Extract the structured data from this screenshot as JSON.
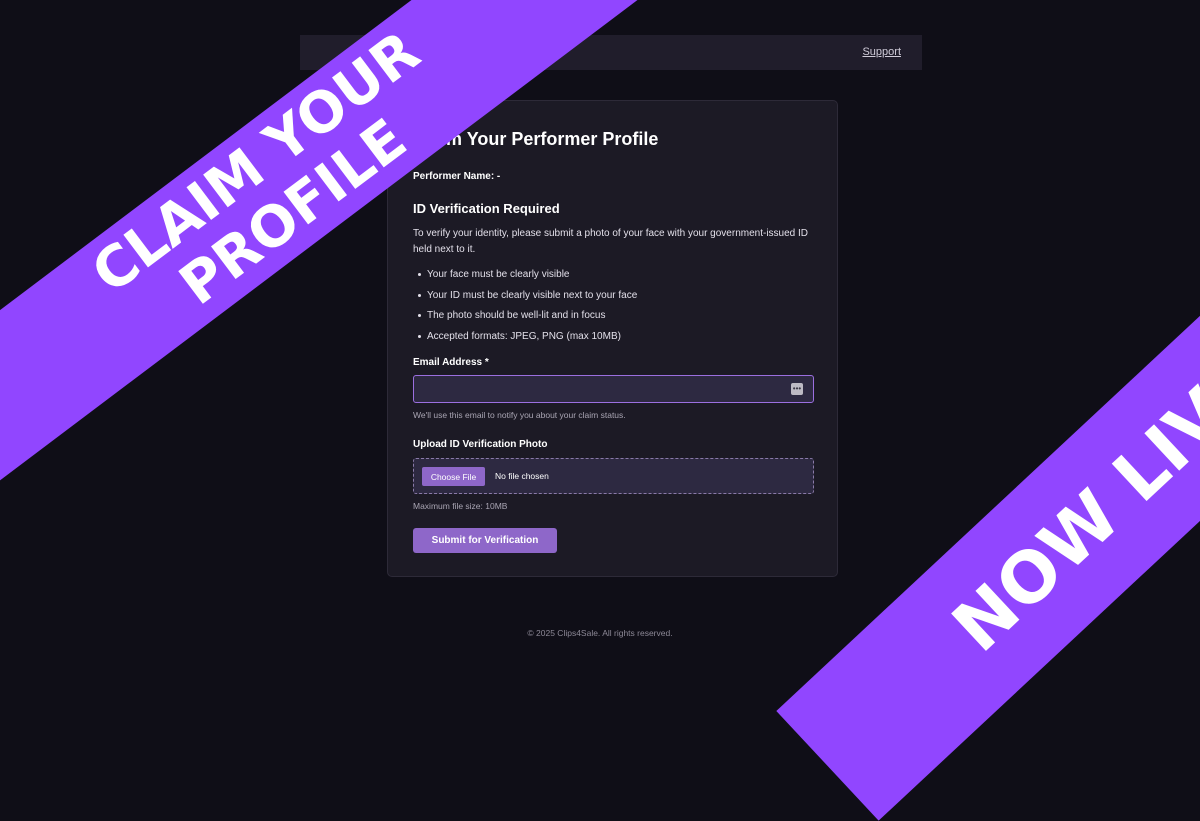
{
  "header": {
    "support_label": "Support"
  },
  "card": {
    "title": "Claim Your Performer Profile",
    "performer_name": "Performer Name: -",
    "section_title": "ID Verification Required",
    "intro": "To verify your identity, please submit a photo of your face with your government-issued ID held next to it.",
    "requirements": [
      "Your face must be clearly visible",
      "Your ID must be clearly visible next to your face",
      "The photo should be well-lit and in focus",
      "Accepted formats: JPEG, PNG (max 10MB)"
    ],
    "email": {
      "label": "Email Address *",
      "value": "",
      "helper": "We'll use this email to notify you about your claim status."
    },
    "upload": {
      "label": "Upload ID Verification Photo",
      "button_label": "Choose File",
      "status": "No file chosen",
      "helper": "Maximum file size: 10MB"
    },
    "submit_label": "Submit for Verification"
  },
  "footer": {
    "text": "© 2025 Clips4Sale. All rights reserved."
  },
  "banners": {
    "left_line1": "CLAIM YOUR",
    "left_line2": "PROFILE",
    "right_text": "NOW LIVE!"
  },
  "colors": {
    "background": "#0f0e17",
    "card": "#1c1a25",
    "accent": "#8e67c9",
    "banner": "#9146ff"
  }
}
